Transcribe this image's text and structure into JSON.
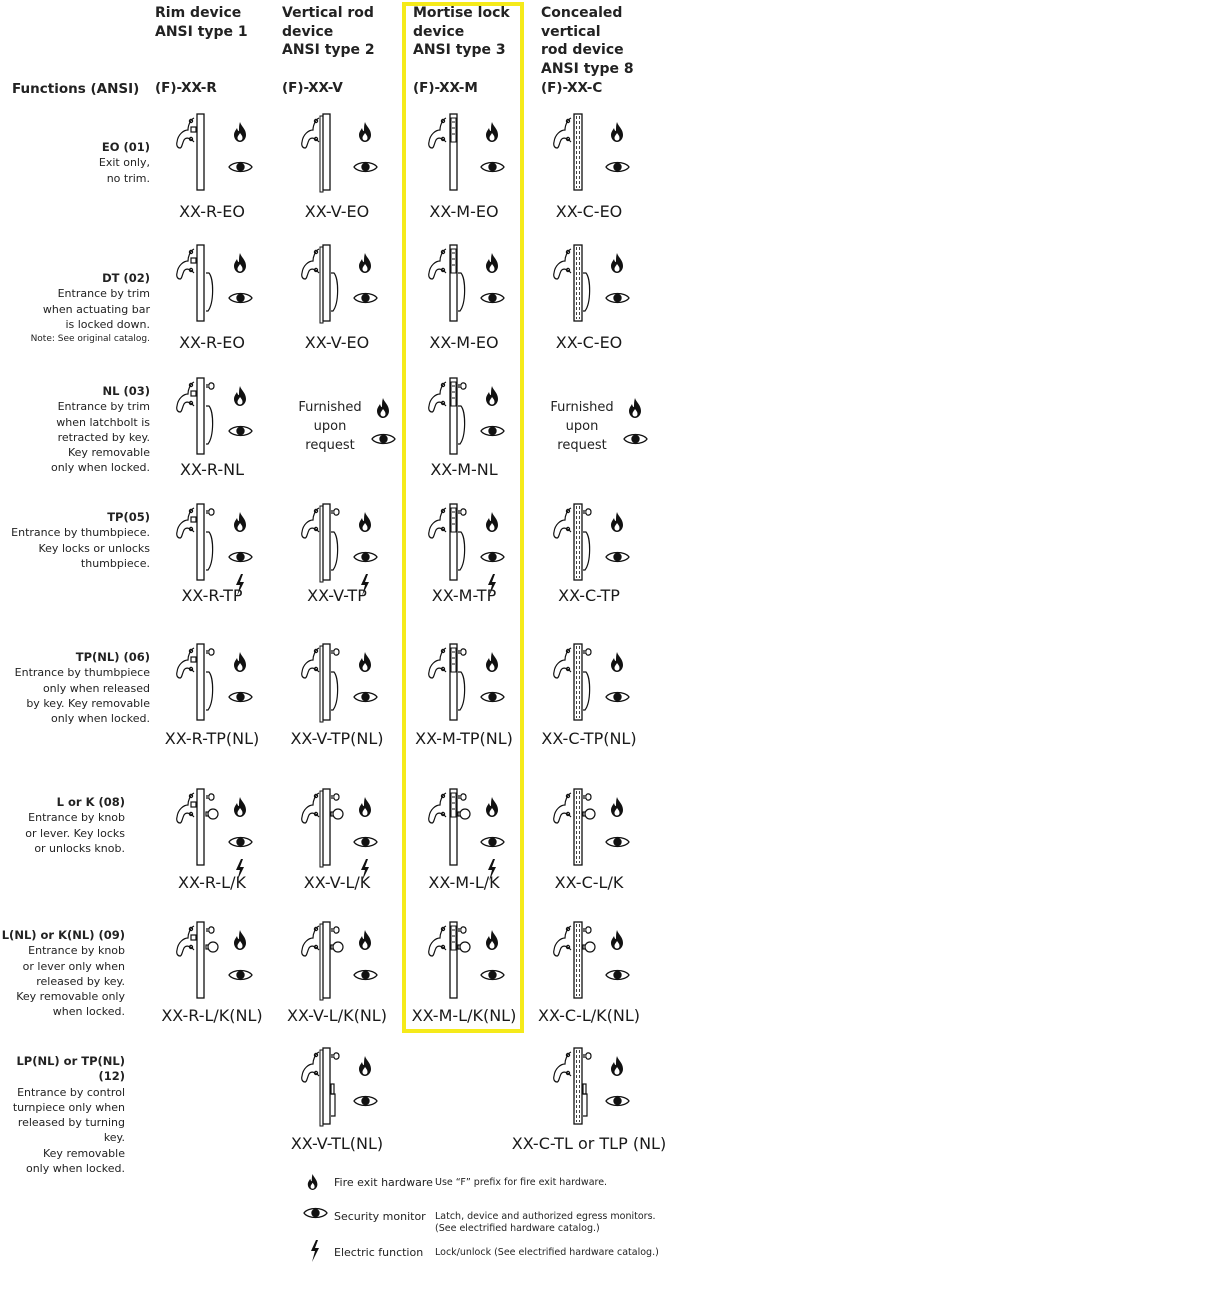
{
  "header": {
    "functions_label": "Functions (ANSI)",
    "columns": [
      {
        "title": "Rim device\nANSI type 1",
        "code": "(F)-XX-R",
        "key": "R"
      },
      {
        "title": "Vertical rod\ndevice\nANSI type 2",
        "code": "(F)-XX-V",
        "key": "V"
      },
      {
        "title": "Mortise lock\ndevice\nANSI type 3",
        "code": "(F)-XX-M",
        "key": "M",
        "highlighted": true
      },
      {
        "title": "Concealed\nvertical\nrod device\nANSI type 8",
        "code": "(F)-XX-C",
        "key": "C"
      }
    ]
  },
  "highlight_color": "#f5ea1a",
  "functions": [
    {
      "title": "EO (01)",
      "desc": "Exit only,\nno trim.",
      "note": "",
      "cells": [
        {
          "label": "XX-R-EO",
          "icons": [
            "fire-icon",
            "eye-icon"
          ]
        },
        {
          "label": "XX-V-EO",
          "icons": [
            "fire-icon",
            "eye-icon"
          ]
        },
        {
          "label": "XX-M-EO",
          "icons": [
            "fire-icon",
            "eye-icon"
          ]
        },
        {
          "label": "XX-C-EO",
          "icons": [
            "fire-icon",
            "eye-icon"
          ]
        }
      ]
    },
    {
      "title": "DT (02)",
      "desc": "Entrance by trim\nwhen actuating bar\nis locked down.",
      "note": "Note: See original catalog.",
      "cells": [
        {
          "label": "XX-R-EO",
          "icons": [
            "fire-icon",
            "eye-icon"
          ]
        },
        {
          "label": "XX-V-EO",
          "icons": [
            "fire-icon",
            "eye-icon"
          ]
        },
        {
          "label": "XX-M-EO",
          "icons": [
            "fire-icon",
            "eye-icon"
          ]
        },
        {
          "label": "XX-C-EO",
          "icons": [
            "fire-icon",
            "eye-icon"
          ]
        }
      ]
    },
    {
      "title": "NL (03)",
      "desc": "Entrance by trim\nwhen latchbolt is\nretracted by key.\nKey removable\nonly when locked.",
      "note": "",
      "cells": [
        {
          "label": "XX-R-NL",
          "icons": [
            "fire-icon",
            "eye-icon"
          ]
        },
        {
          "label": "",
          "furnished": "Furnished\nupon\nrequest",
          "icons": [
            "fire-icon",
            "eye-icon"
          ]
        },
        {
          "label": "XX-M-NL",
          "icons": [
            "fire-icon",
            "eye-icon"
          ]
        },
        {
          "label": "",
          "furnished": "Furnished\nupon\nrequest",
          "icons": [
            "fire-icon",
            "eye-icon"
          ]
        }
      ]
    },
    {
      "title": "TP(05)",
      "desc": "Entrance by thumbpiece.\nKey locks or unlocks\nthumbpiece.",
      "note": "",
      "cells": [
        {
          "label": "XX-R-TP",
          "icons": [
            "fire-icon",
            "eye-icon",
            "lightning-icon"
          ]
        },
        {
          "label": "XX-V-TP",
          "icons": [
            "fire-icon",
            "eye-icon",
            "lightning-icon"
          ]
        },
        {
          "label": "XX-M-TP",
          "icons": [
            "fire-icon",
            "eye-icon",
            "lightning-icon"
          ]
        },
        {
          "label": "XX-C-TP",
          "icons": [
            "fire-icon",
            "eye-icon"
          ]
        }
      ]
    },
    {
      "title": "TP(NL)  (06)",
      "desc": "Entrance by thumbpiece\nonly when released\nby key. Key removable\nonly when locked.",
      "note": "",
      "cells": [
        {
          "label": "XX-R-TP(NL)",
          "icons": [
            "fire-icon",
            "eye-icon"
          ]
        },
        {
          "label": "XX-V-TP(NL)",
          "icons": [
            "fire-icon",
            "eye-icon"
          ]
        },
        {
          "label": "XX-M-TP(NL)",
          "icons": [
            "fire-icon",
            "eye-icon"
          ]
        },
        {
          "label": "XX-C-TP(NL)",
          "icons": [
            "fire-icon",
            "eye-icon"
          ]
        }
      ]
    },
    {
      "title": "L or K (08)",
      "desc": "Entrance by knob\nor lever. Key locks\nor unlocks knob.",
      "note": "",
      "cells": [
        {
          "label": "XX-R-L/K",
          "icons": [
            "fire-icon",
            "eye-icon",
            "lightning-icon"
          ]
        },
        {
          "label": "XX-V-L/K",
          "icons": [
            "fire-icon",
            "eye-icon",
            "lightning-icon"
          ]
        },
        {
          "label": "XX-M-L/K",
          "icons": [
            "fire-icon",
            "eye-icon",
            "lightning-icon"
          ]
        },
        {
          "label": "XX-C-L/K",
          "icons": [
            "fire-icon",
            "eye-icon"
          ]
        }
      ]
    },
    {
      "title": "L(NL) or K(NL) (09)",
      "desc": "Entrance by knob\nor lever only when\nreleased by key.\nKey removable only\nwhen locked.",
      "note": "",
      "cells": [
        {
          "label": "XX-R-L/K(NL)",
          "icons": [
            "fire-icon",
            "eye-icon"
          ]
        },
        {
          "label": "XX-V-L/K(NL)",
          "icons": [
            "fire-icon",
            "eye-icon"
          ]
        },
        {
          "label": "XX-M-L/K(NL)",
          "icons": [
            "fire-icon",
            "eye-icon"
          ]
        },
        {
          "label": "XX-C-L/K(NL)",
          "icons": [
            "fire-icon",
            "eye-icon"
          ]
        }
      ]
    },
    {
      "title": "LP(NL) or TP(NL) (12)",
      "desc": "Entrance by control\nturnpiece only when\nreleased by turning key.\nKey removable\nonly when locked.",
      "note": "",
      "cells": [
        null,
        {
          "label": "XX-V-TL(NL)",
          "icons": [
            "fire-icon",
            "eye-icon"
          ]
        },
        null,
        {
          "label": "XX-C-TL or TLP (NL)",
          "icons": [
            "fire-icon",
            "eye-icon"
          ]
        }
      ]
    }
  ],
  "legend": [
    {
      "icon": "fire-icon",
      "label": "Fire exit hardware",
      "desc": "Use “F” prefix for fire exit hardware."
    },
    {
      "icon": "eye-icon",
      "label": "Security monitor",
      "desc": "Latch, device and authorized egress monitors.\n(See electrified hardware catalog.)"
    },
    {
      "icon": "lightning-icon",
      "label": "Electric function",
      "desc": "Lock/unlock (See electrified hardware catalog.)"
    }
  ]
}
